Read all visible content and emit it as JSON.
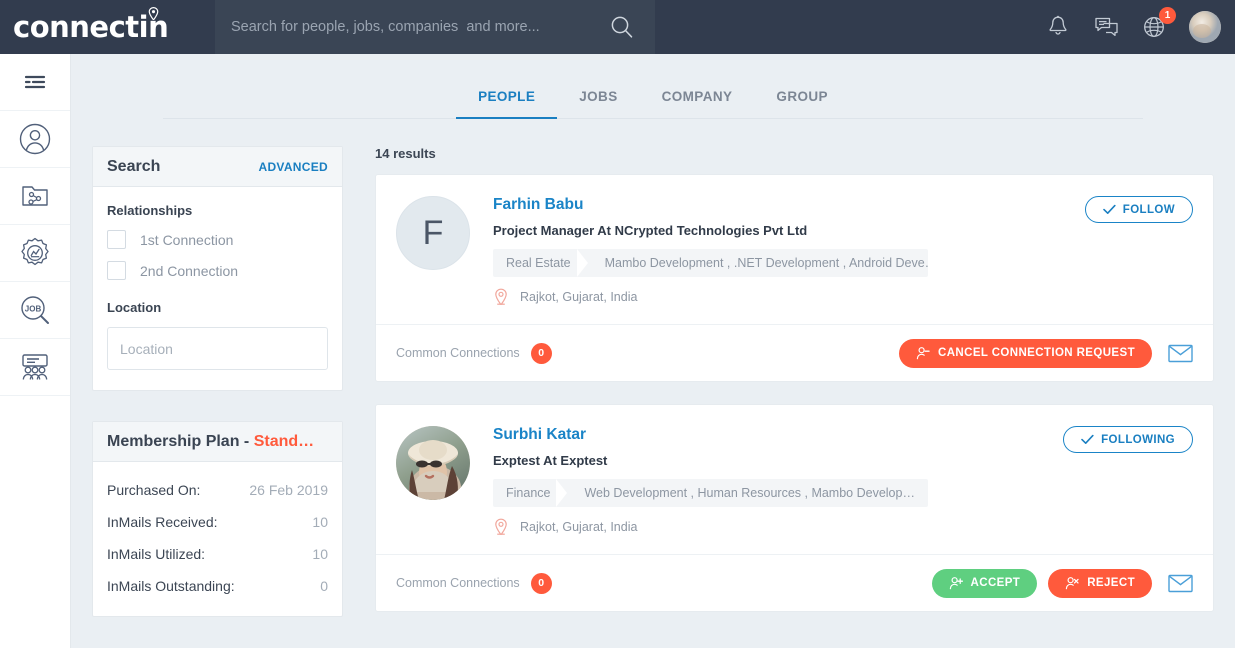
{
  "brand": {
    "name": "connectin",
    "logo_pin_icon": "location-pin-icon",
    "header_bg": "#323c4e",
    "accent_blue": "#1a7fc1",
    "accent_orange": "#ff5a3c",
    "accent_green": "#5fcf80"
  },
  "search": {
    "value": "",
    "placeholder": "Search for people, jobs, companies  and more...",
    "icon": "search-icon"
  },
  "header_icons": {
    "bell": "bell-icon",
    "messages": "chat-bubbles-icon",
    "globe": "globe-icon",
    "globe_badge": "1",
    "avatar": "user-avatar"
  },
  "rail": {
    "items": [
      {
        "icon": "hamburger-menu-icon",
        "name": "menu"
      },
      {
        "icon": "user-profile-icon",
        "name": "profile"
      },
      {
        "icon": "shared-folder-icon",
        "name": "shared-files"
      },
      {
        "icon": "analytics-badge-icon",
        "name": "analytics"
      },
      {
        "icon": "job-search-icon",
        "name": "jobs"
      },
      {
        "icon": "groups-icon",
        "name": "groups"
      }
    ]
  },
  "tabs": [
    {
      "label": "PEOPLE",
      "active": true
    },
    {
      "label": "JOBS",
      "active": false
    },
    {
      "label": "COMPANY",
      "active": false
    },
    {
      "label": "GROUP",
      "active": false
    }
  ],
  "filters": {
    "title": "Search",
    "advanced_label": "ADVANCED",
    "relationships_label": "Relationships",
    "checkboxes": [
      {
        "label": "1st Connection",
        "checked": false
      },
      {
        "label": "2nd Connection",
        "checked": false
      }
    ],
    "location_label": "Location",
    "location_value": "",
    "location_placeholder": "Location"
  },
  "membership": {
    "title_prefix": "Membership Plan - ",
    "plan_name": "Stand…",
    "rows": [
      {
        "key": "Purchased On:",
        "value": "26 Feb 2019"
      },
      {
        "key": "InMails Received:",
        "value": "10"
      },
      {
        "key": "InMails Utilized:",
        "value": "10"
      },
      {
        "key": "InMails Outstanding:",
        "value": "0"
      }
    ]
  },
  "results": {
    "count_label": "14 results",
    "cards": [
      {
        "name": "Farhin Babu",
        "avatar_type": "letter",
        "avatar_letter": "F",
        "title": "Project Manager At NCrypted Technologies Pvt Ltd",
        "industry": "Real Estate",
        "skills": "Mambo Development , .NET Development , Android Deve…",
        "location": "Rajkot, Gujarat, India",
        "location_icon": "location-pin-icon",
        "follow_label": "FOLLOW",
        "follow_icon": "check-icon",
        "common_label": "Common Connections",
        "common_count": "0",
        "actions": [
          {
            "label": "CANCEL CONNECTION REQUEST",
            "style": "orange",
            "icon": "person-minus-icon"
          }
        ],
        "mail_icon": "envelope-icon"
      },
      {
        "name": "Surbhi Katar",
        "avatar_type": "photo",
        "avatar_letter": "",
        "title": "Exptest At Exptest",
        "industry": "Finance",
        "skills": "Web Development , Human Resources , Mambo Develop…",
        "location": "Rajkot, Gujarat, India",
        "location_icon": "location-pin-icon",
        "follow_label": "FOLLOWING",
        "follow_icon": "check-icon",
        "common_label": "Common Connections",
        "common_count": "0",
        "actions": [
          {
            "label": "ACCEPT",
            "style": "green",
            "icon": "person-check-icon"
          },
          {
            "label": "REJECT",
            "style": "red",
            "icon": "person-x-icon"
          }
        ],
        "mail_icon": "envelope-icon"
      }
    ]
  }
}
